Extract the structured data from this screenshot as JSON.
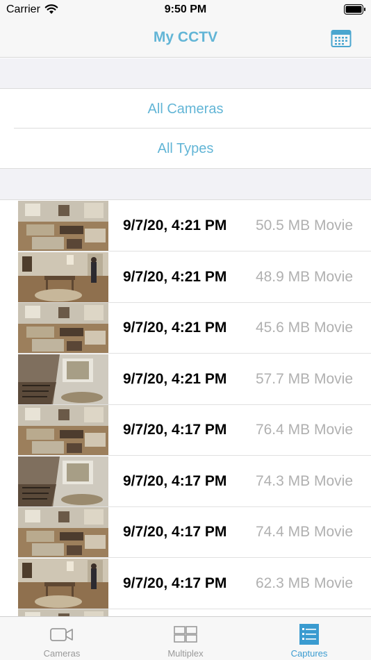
{
  "status_bar": {
    "carrier": "Carrier",
    "time": "9:50 PM"
  },
  "nav": {
    "title": "My CCTV",
    "calendar_icon": "calendar-icon"
  },
  "filters": {
    "cameras": "All Cameras",
    "types": "All Types"
  },
  "captures": [
    {
      "date": "9/7/20, 4:21 PM",
      "size": "50.5 MB Movie",
      "thumbnail": "living-room"
    },
    {
      "date": "9/7/20, 4:21 PM",
      "size": "48.9 MB Movie",
      "thumbnail": "hallway-person"
    },
    {
      "date": "9/7/20, 4:21 PM",
      "size": "45.6 MB Movie",
      "thumbnail": "living-room"
    },
    {
      "date": "9/7/20, 4:21 PM",
      "size": "57.7 MB Movie",
      "thumbnail": "stairway"
    },
    {
      "date": "9/7/20, 4:17 PM",
      "size": "76.4 MB Movie",
      "thumbnail": "living-room"
    },
    {
      "date": "9/7/20, 4:17 PM",
      "size": "74.3 MB Movie",
      "thumbnail": "stairway"
    },
    {
      "date": "9/7/20, 4:17 PM",
      "size": "74.4 MB Movie",
      "thumbnail": "living-room"
    },
    {
      "date": "9/7/20, 4:17 PM",
      "size": "62.3 MB Movie",
      "thumbnail": "hallway-person"
    },
    {
      "date": "",
      "size": "",
      "thumbnail": "living-room"
    }
  ],
  "tabs": [
    {
      "label": "Cameras",
      "icon": "video-camera-icon",
      "selected": false
    },
    {
      "label": "Multiplex",
      "icon": "grid-icon",
      "selected": false
    },
    {
      "label": "Captures",
      "icon": "list-icon",
      "selected": true
    }
  ],
  "colors": {
    "accent": "#62b5d6",
    "tab_selected": "#3a9bd0",
    "secondary_text": "#b0b0b0"
  }
}
